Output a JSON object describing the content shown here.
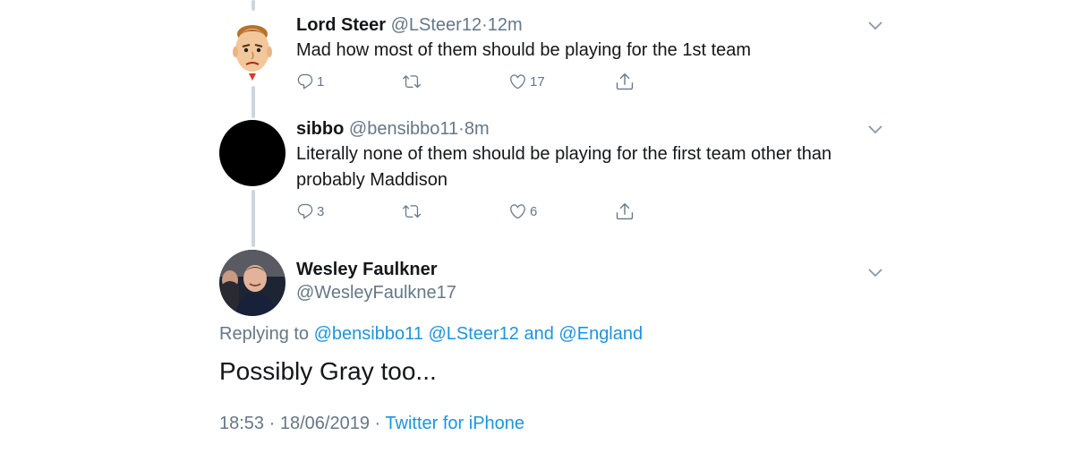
{
  "tweets": [
    {
      "name": "Lord Steer",
      "handle": "@LSteer12",
      "separator": "·",
      "time": "12m",
      "text": "Mad how most of them should be playing for the 1st team",
      "replies": "1",
      "likes": "17"
    },
    {
      "name": "sibbo",
      "handle": "@bensibbo11",
      "separator": "·",
      "time": "8m",
      "text_line1": "Literally none of them should be playing for the first team other than",
      "text_line2": "probably Maddison",
      "replies": "3",
      "likes": "6"
    }
  ],
  "focused": {
    "name": "Wesley Faulkner",
    "handle": "@WesleyFaulkne17",
    "replying_prefix": "Replying to",
    "mention1": "@bensibbo11",
    "mention2": "@LSteer12",
    "and": "and",
    "mention3": "@England",
    "text": "Possibly Gray too...",
    "time": "18:53",
    "date_sep": "·",
    "date": "18/06/2019",
    "source_sep": "·",
    "source": "Twitter for iPhone"
  },
  "colors": {
    "link": "#1b95e0",
    "muted": "#657786",
    "text": "#14171a",
    "thread_line": "#ccd6dd"
  },
  "icons": [
    "reply-icon",
    "retweet-icon",
    "like-icon",
    "share-icon",
    "chevron-down-icon"
  ]
}
